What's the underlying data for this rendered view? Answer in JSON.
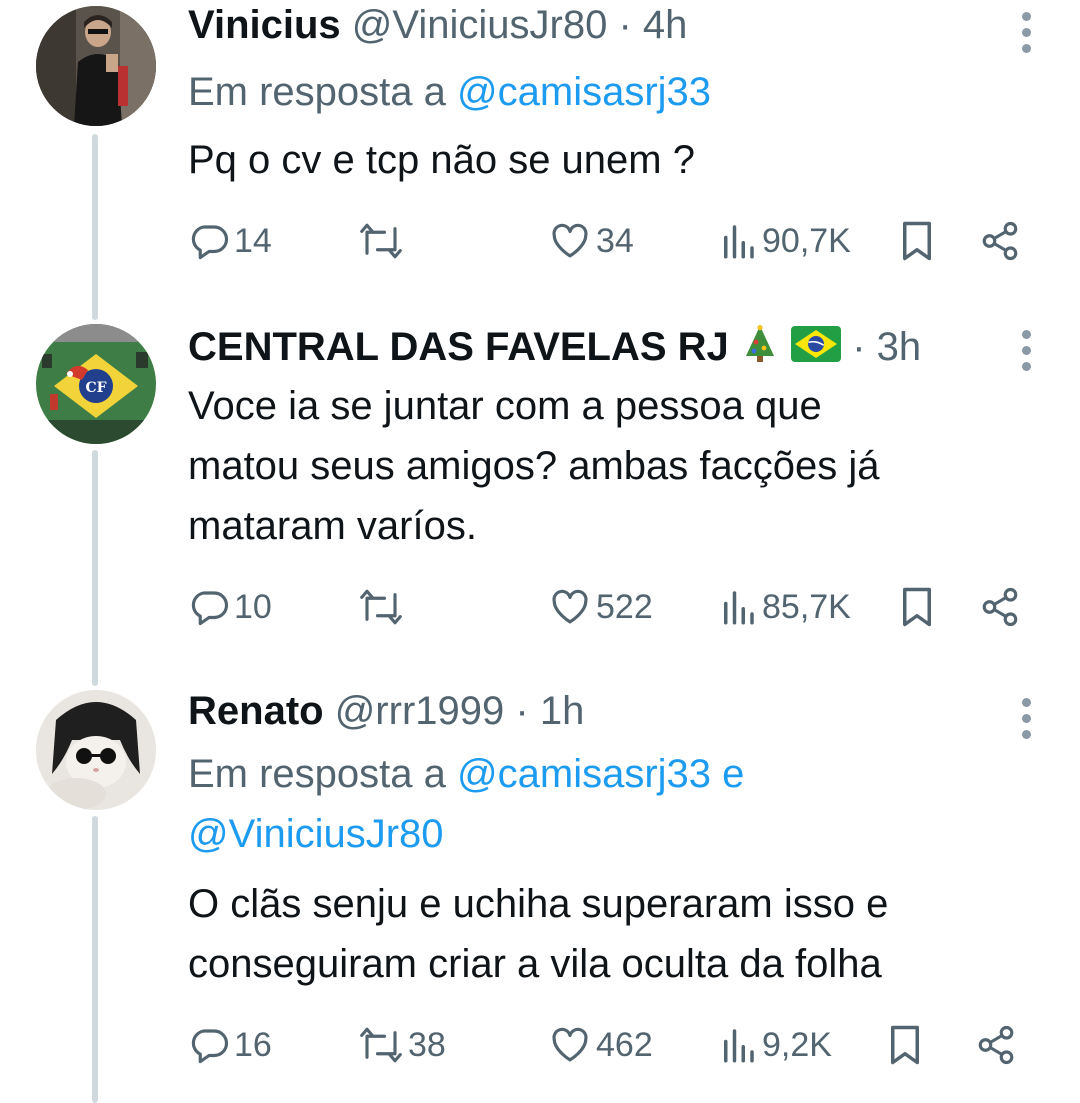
{
  "tweets": [
    {
      "name": "Vinicius",
      "handle": "@ViniciusJr80",
      "sep": "·",
      "time": "4h",
      "reply_prefix": "Em resposta a",
      "reply_targets": "@camisasrj33",
      "reply_targets_line2": "",
      "text_lines": [
        "Pq o cv e tcp não se unem ?"
      ],
      "replies": "14",
      "retweets": "",
      "likes": "34",
      "views": "90,7K"
    },
    {
      "name": "CENTRAL DAS FAVELAS RJ",
      "name_emojis": [
        "christmas-tree-emoji",
        "brazil-flag-emoji"
      ],
      "handle": "",
      "sep": "·",
      "time": "3h",
      "text_lines": [
        "Voce ia se juntar com a pessoa que",
        "matou seus amigos? ambas facções já",
        "mataram varíos."
      ],
      "replies": "10",
      "retweets": "",
      "likes": "522",
      "views": "85,7K"
    },
    {
      "name": "Renato",
      "handle": "@rrr1999",
      "sep": "·",
      "time": "1h",
      "reply_prefix": "Em resposta a",
      "reply_targets": "@camisasrj33 e",
      "reply_targets_line2": "@ViniciusJr80",
      "text_lines": [
        "O clãs senju e uchiha superaram isso e",
        "conseguiram criar a vila oculta da folha"
      ],
      "replies": "16",
      "retweets": "38",
      "likes": "462",
      "views": "9,2K"
    }
  ],
  "icons": {
    "reply": "reply-icon",
    "retweet": "retweet-icon",
    "like": "heart-icon",
    "views": "views-icon",
    "bookmark": "bookmark-icon",
    "share": "share-icon",
    "more": "more-vertical-icon"
  },
  "colors": {
    "text": "#0f1419",
    "secondary": "#536471",
    "link": "#1d9bf0",
    "thread_line": "#cfd9de"
  }
}
